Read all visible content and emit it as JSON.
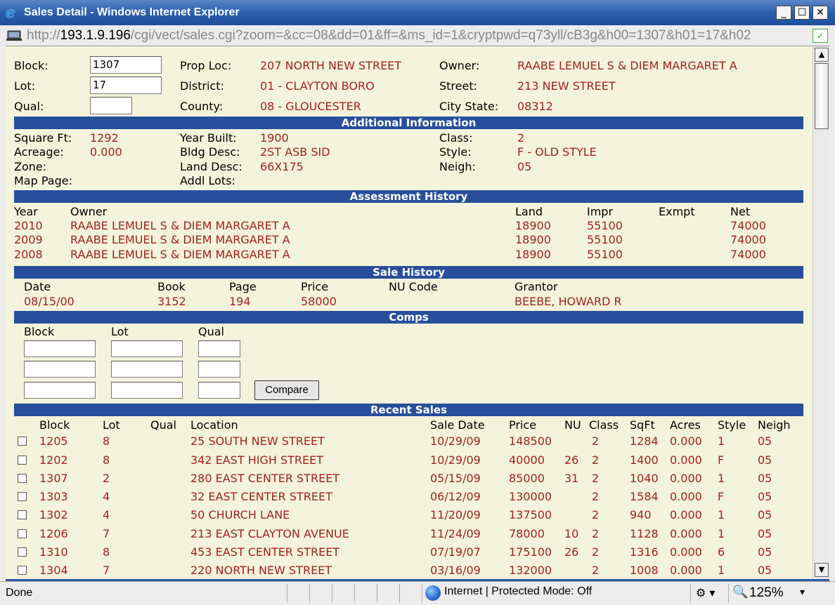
{
  "window": {
    "title": "Sales Detail - Windows Internet Explorer",
    "minimize": "_",
    "maximize": "☐",
    "close": "✕"
  },
  "address": {
    "url_prefix": "http://",
    "url_host": "193.1.9.196",
    "url_path": "/cgi/vect/sales.cgi?zoom=&cc=08&dd=01&ff=&ms_id=1&cryptpwd=q73yll/cB3g&h00=1307&h01=17&h02"
  },
  "property": {
    "block_label": "Block:",
    "block_value": "1307",
    "lot_label": "Lot:",
    "lot_value": "17",
    "qual_label": "Qual:",
    "qual_value": "",
    "proploc_label": "Prop Loc:",
    "proploc_value": "207 NORTH NEW STREET",
    "district_label": "District:",
    "district_value": "01 - CLAYTON BORO",
    "county_label": "County:",
    "county_value": "08 - GLOUCESTER",
    "owner_label": "Owner:",
    "owner_value": "RAABE LEMUEL S & DIEM MARGARET A",
    "street_label": "Street:",
    "street_value": "213 NEW STREET",
    "citystate_label": "City State:",
    "citystate_value": "08312"
  },
  "additional": {
    "header": "Additional Information",
    "sqft_label": "Square Ft:",
    "sqft_value": "1292",
    "acreage_label": "Acreage:",
    "acreage_value": "0.000",
    "zone_label": "Zone:",
    "zone_value": "",
    "mappage_label": "Map Page:",
    "mappage_value": "",
    "yearbuilt_label": "Year Built:",
    "yearbuilt_value": "1900",
    "bldgdesc_label": "Bldg Desc:",
    "bldgdesc_value": "2ST ASB SID",
    "landdesc_label": "Land Desc:",
    "landdesc_value": "66X175",
    "addllots_label": "Addl Lots:",
    "addllots_value": "",
    "class_label": "Class:",
    "class_value": "2",
    "style_label": "Style:",
    "style_value": "F - OLD STYLE",
    "neigh_label": "Neigh:",
    "neigh_value": "05"
  },
  "assessment": {
    "header": "Assessment History",
    "columns": [
      "Year",
      "Owner",
      "Land",
      "Impr",
      "Exmpt",
      "Net"
    ],
    "rows": [
      [
        "2010",
        "RAABE LEMUEL S & DIEM MARGARET A",
        "18900",
        "55100",
        "",
        "74000"
      ],
      [
        "2009",
        "RAABE LEMUEL S & DIEM MARGARET A",
        "18900",
        "55100",
        "",
        "74000"
      ],
      [
        "2008",
        "RAABE LEMUEL S & DIEM MARGARET A",
        "18900",
        "55100",
        "",
        "74000"
      ]
    ]
  },
  "sale_history": {
    "header": "Sale History",
    "columns": [
      "Date",
      "Book",
      "Page",
      "Price",
      "NU Code",
      "Grantor"
    ],
    "rows": [
      [
        "08/15/00",
        "3152",
        "194",
        "58000",
        "",
        "BEEBE, HOWARD R"
      ]
    ]
  },
  "comps": {
    "header": "Comps",
    "columns": [
      "Block",
      "Lot",
      "Qual"
    ],
    "compare_button": "Compare"
  },
  "recent": {
    "header": "Recent Sales",
    "columns": [
      "Block",
      "Lot",
      "Qual",
      "Location",
      "Sale Date",
      "Price",
      "NU",
      "Class",
      "SqFt",
      "Acres",
      "Style",
      "Neigh"
    ],
    "rows": [
      [
        "1205",
        "8",
        "",
        "25 SOUTH NEW STREET",
        "10/29/09",
        "148500",
        "",
        "2",
        "1284",
        "0.000",
        "1",
        "05"
      ],
      [
        "1202",
        "8",
        "",
        "342 EAST HIGH STREET",
        "10/29/09",
        "40000",
        "26",
        "2",
        "1400",
        "0.000",
        "F",
        "05"
      ],
      [
        "1307",
        "2",
        "",
        "280 EAST CENTER STREET",
        "05/15/09",
        "85000",
        "31",
        "2",
        "1040",
        "0.000",
        "1",
        "05"
      ],
      [
        "1303",
        "4",
        "",
        "32 EAST CENTER STREET",
        "06/12/09",
        "130000",
        "",
        "2",
        "1584",
        "0.000",
        "F",
        "05"
      ],
      [
        "1302",
        "4",
        "",
        "50 CHURCH LANE",
        "11/20/09",
        "137500",
        "",
        "2",
        "940",
        "0.000",
        "1",
        "05"
      ],
      [
        "1206",
        "7",
        "",
        "213 EAST CLAYTON AVENUE",
        "11/24/09",
        "78000",
        "10",
        "2",
        "1128",
        "0.000",
        "1",
        "05"
      ],
      [
        "1310",
        "8",
        "",
        "453 EAST CENTER STREET",
        "07/19/07",
        "175100",
        "26",
        "2",
        "1316",
        "0.000",
        "6",
        "05"
      ],
      [
        "1304",
        "7",
        "",
        "220 NORTH NEW STREET",
        "03/16/09",
        "132000",
        "",
        "2",
        "1008",
        "0.000",
        "1",
        "05"
      ]
    ]
  },
  "status": {
    "text": "Done",
    "zone": "Internet | Protected Mode: Off",
    "zoom": "125%"
  }
}
